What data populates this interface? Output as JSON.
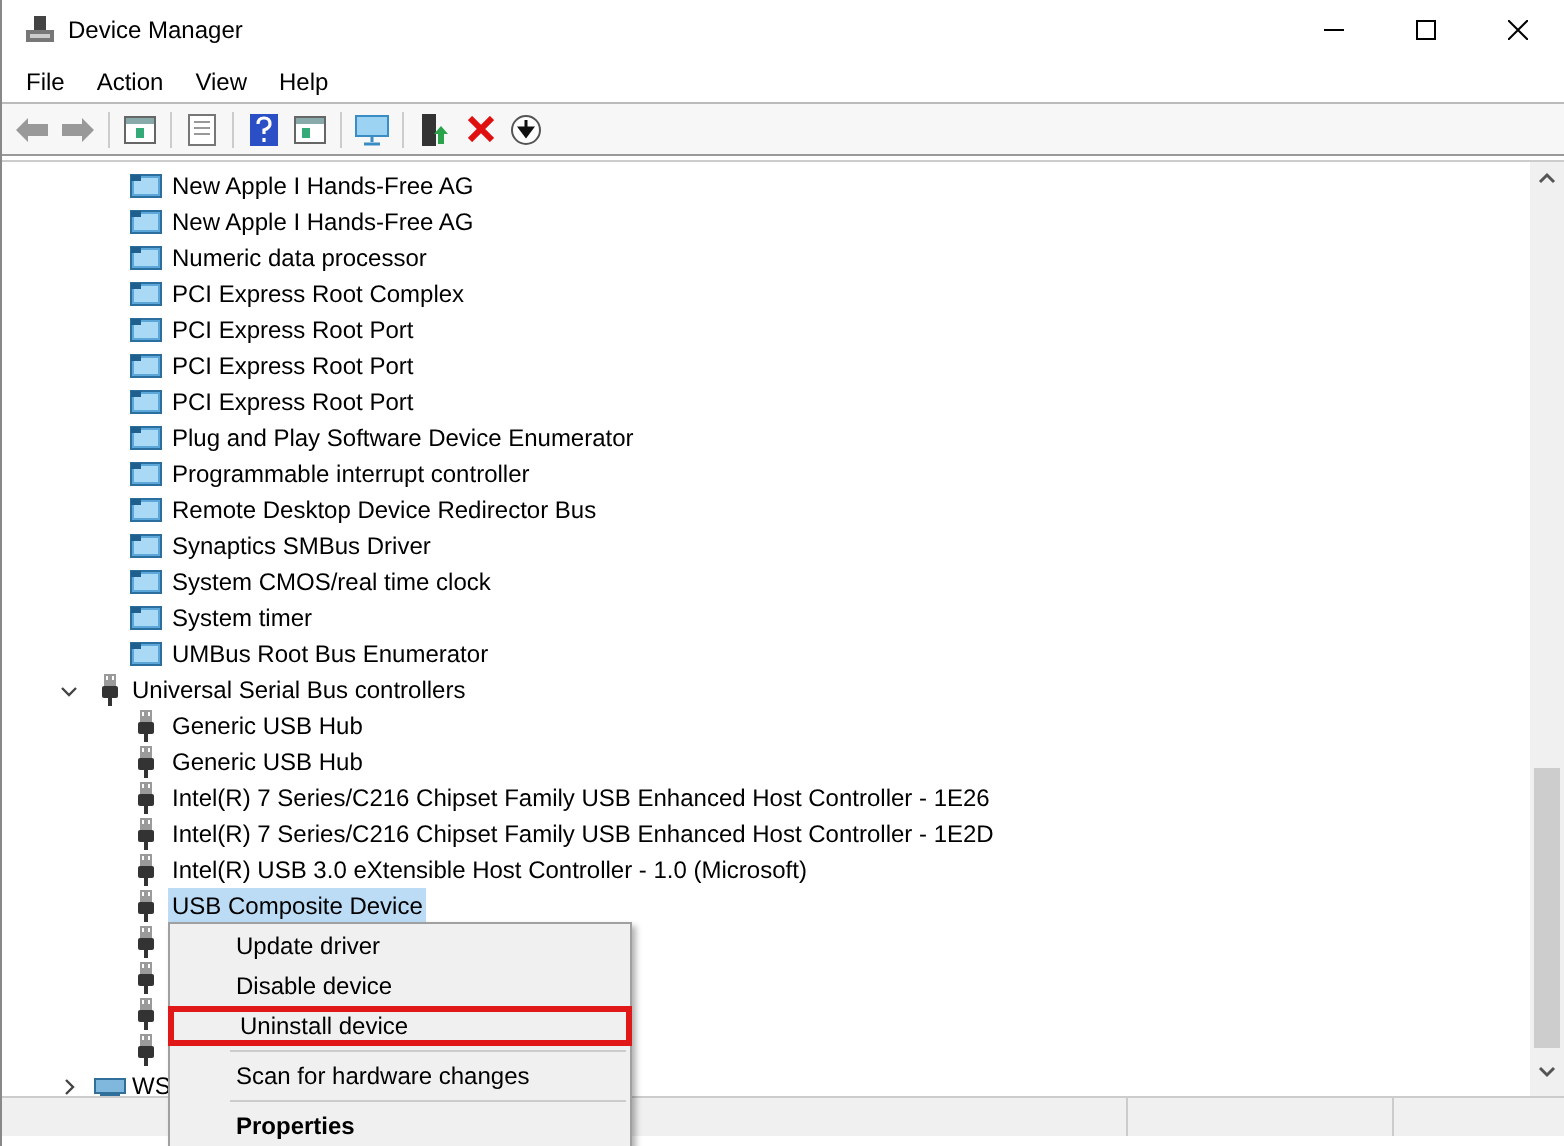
{
  "window": {
    "title": "Device Manager"
  },
  "menu": [
    "File",
    "Action",
    "View",
    "Help"
  ],
  "tree": [
    {
      "kind": "devices",
      "children": [
        {
          "kind": "device",
          "label": "New Apple I Hands-Free AG",
          "selected": false
        },
        {
          "kind": "device",
          "label": "New Apple I Hands-Free AG",
          "selected": false
        },
        {
          "kind": "device",
          "label": "Numeric data processor",
          "selected": false
        },
        {
          "kind": "device",
          "label": "PCI Express Root Complex",
          "selected": false
        },
        {
          "kind": "device",
          "label": "PCI Express Root Port",
          "selected": false
        },
        {
          "kind": "device",
          "label": "PCI Express Root Port",
          "selected": false
        },
        {
          "kind": "device",
          "label": "PCI Express Root Port",
          "selected": false
        },
        {
          "kind": "device",
          "label": "Plug and Play Software Device Enumerator",
          "selected": false
        },
        {
          "kind": "device",
          "label": "Programmable interrupt controller",
          "selected": false
        },
        {
          "kind": "device",
          "label": "Remote Desktop Device Redirector Bus",
          "selected": false
        },
        {
          "kind": "device",
          "label": "Synaptics SMBus Driver",
          "selected": false
        },
        {
          "kind": "device",
          "label": "System CMOS/real time clock",
          "selected": false
        },
        {
          "kind": "device",
          "label": "System timer",
          "selected": false
        },
        {
          "kind": "device",
          "label": "UMBus Root Bus Enumerator",
          "selected": false
        }
      ]
    },
    {
      "kind": "usb",
      "label": "Universal Serial Bus controllers",
      "expanded": true,
      "children": [
        {
          "kind": "device",
          "label": "Generic USB Hub",
          "selected": false
        },
        {
          "kind": "device",
          "label": "Generic USB Hub",
          "selected": false
        },
        {
          "kind": "device",
          "label": "Intel(R) 7 Series/C216 Chipset Family USB Enhanced Host Controller - 1E26",
          "selected": false
        },
        {
          "kind": "device",
          "label": "Intel(R) 7 Series/C216 Chipset Family USB Enhanced Host Controller - 1E2D",
          "selected": false
        },
        {
          "kind": "device",
          "label": "Intel(R) USB 3.0 eXtensible Host Controller - 1.0 (Microsoft)",
          "selected": false
        },
        {
          "kind": "device",
          "label": "USB Composite Device",
          "selected": true
        },
        {
          "kind": "covered"
        },
        {
          "kind": "covered"
        },
        {
          "kind": "covered"
        },
        {
          "kind": "covered"
        }
      ]
    },
    {
      "kind": "network",
      "label": "WS",
      "expanded": false
    }
  ],
  "context_menu": [
    {
      "kind": "item",
      "label": "Update driver",
      "highlighted": false,
      "bold": false
    },
    {
      "kind": "item",
      "label": "Disable device",
      "highlighted": false,
      "bold": false
    },
    {
      "kind": "item",
      "label": "Uninstall device",
      "highlighted": true,
      "bold": false
    },
    {
      "kind": "separator"
    },
    {
      "kind": "item",
      "label": "Scan for hardware changes",
      "highlighted": false,
      "bold": false
    },
    {
      "kind": "separator"
    },
    {
      "kind": "item",
      "label": "Properties",
      "highlighted": false,
      "bold": true
    }
  ]
}
